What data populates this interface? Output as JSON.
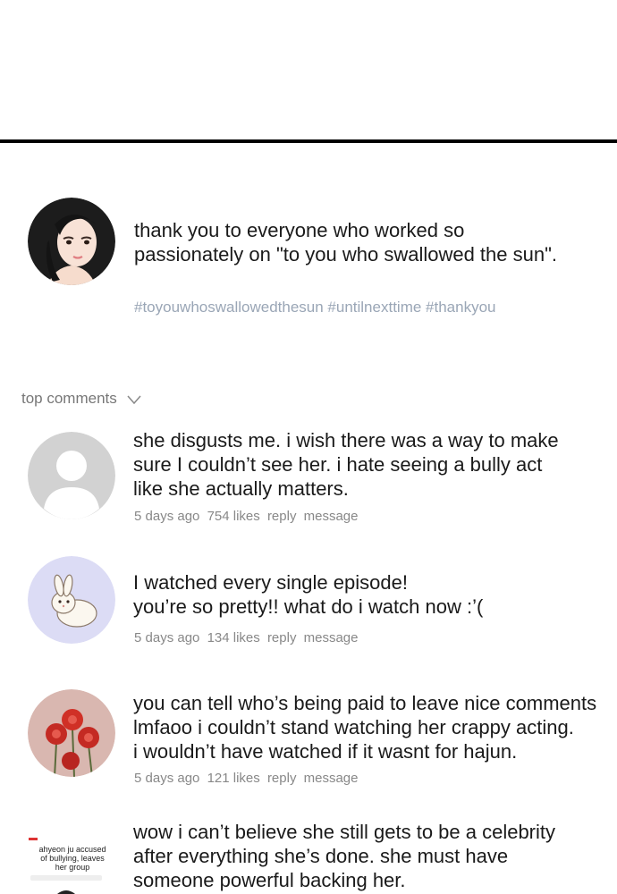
{
  "post": {
    "text_lines": [
      "thank you to everyone who worked so",
      "passionately on \"to you who swallowed the sun\"."
    ],
    "hashtags": "#toyouwhoswallowedthesun #untilnexttime #thankyou"
  },
  "top_comments_label": "top comments",
  "comments": [
    {
      "lines": [
        "she disgusts me. i wish there was a way to make",
        "sure I couldn’t see her. i hate seeing a bully act",
        "like she actually matters."
      ],
      "time": "5 days ago",
      "likes": "754 likes",
      "reply": "reply",
      "message": "message"
    },
    {
      "lines": [
        "I watched every single episode!",
        "you’re so pretty!! what do i watch now :’("
      ],
      "time": "5 days ago",
      "likes": "134 likes",
      "reply": "reply",
      "message": "message"
    },
    {
      "lines": [
        "you can tell who’s being paid to leave nice comments",
        "lmfaoo i couldn’t stand watching her crappy acting.",
        "i wouldn’t have watched if it wasnt for hajun."
      ],
      "time": "5 days ago",
      "likes": "121 likes",
      "reply": "reply",
      "message": "message"
    },
    {
      "lines": [
        "wow i can’t believe she still gets to be a celebrity",
        "after everything she’s done. she must have",
        "someone powerful backing her."
      ],
      "avatar_headline": "ahyeon ju accused of bullying, leaves her group"
    }
  ]
}
